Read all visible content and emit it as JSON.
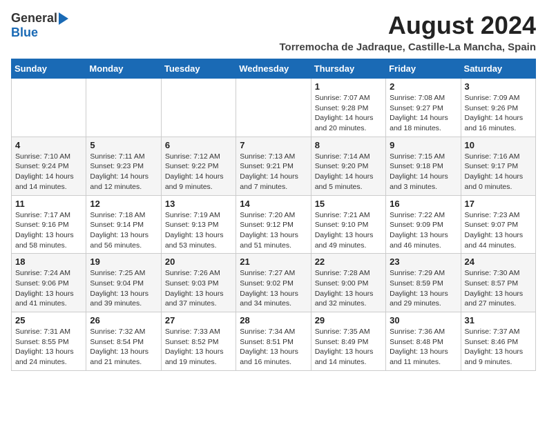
{
  "logo": {
    "general": "General",
    "blue": "Blue"
  },
  "header": {
    "month_year": "August 2024",
    "location": "Torremocha de Jadraque, Castille-La Mancha, Spain"
  },
  "weekdays": [
    "Sunday",
    "Monday",
    "Tuesday",
    "Wednesday",
    "Thursday",
    "Friday",
    "Saturday"
  ],
  "weeks": [
    [
      {
        "day": "",
        "info": ""
      },
      {
        "day": "",
        "info": ""
      },
      {
        "day": "",
        "info": ""
      },
      {
        "day": "",
        "info": ""
      },
      {
        "day": "1",
        "info": "Sunrise: 7:07 AM\nSunset: 9:28 PM\nDaylight: 14 hours and 20 minutes."
      },
      {
        "day": "2",
        "info": "Sunrise: 7:08 AM\nSunset: 9:27 PM\nDaylight: 14 hours and 18 minutes."
      },
      {
        "day": "3",
        "info": "Sunrise: 7:09 AM\nSunset: 9:26 PM\nDaylight: 14 hours and 16 minutes."
      }
    ],
    [
      {
        "day": "4",
        "info": "Sunrise: 7:10 AM\nSunset: 9:24 PM\nDaylight: 14 hours and 14 minutes."
      },
      {
        "day": "5",
        "info": "Sunrise: 7:11 AM\nSunset: 9:23 PM\nDaylight: 14 hours and 12 minutes."
      },
      {
        "day": "6",
        "info": "Sunrise: 7:12 AM\nSunset: 9:22 PM\nDaylight: 14 hours and 9 minutes."
      },
      {
        "day": "7",
        "info": "Sunrise: 7:13 AM\nSunset: 9:21 PM\nDaylight: 14 hours and 7 minutes."
      },
      {
        "day": "8",
        "info": "Sunrise: 7:14 AM\nSunset: 9:20 PM\nDaylight: 14 hours and 5 minutes."
      },
      {
        "day": "9",
        "info": "Sunrise: 7:15 AM\nSunset: 9:18 PM\nDaylight: 14 hours and 3 minutes."
      },
      {
        "day": "10",
        "info": "Sunrise: 7:16 AM\nSunset: 9:17 PM\nDaylight: 14 hours and 0 minutes."
      }
    ],
    [
      {
        "day": "11",
        "info": "Sunrise: 7:17 AM\nSunset: 9:16 PM\nDaylight: 13 hours and 58 minutes."
      },
      {
        "day": "12",
        "info": "Sunrise: 7:18 AM\nSunset: 9:14 PM\nDaylight: 13 hours and 56 minutes."
      },
      {
        "day": "13",
        "info": "Sunrise: 7:19 AM\nSunset: 9:13 PM\nDaylight: 13 hours and 53 minutes."
      },
      {
        "day": "14",
        "info": "Sunrise: 7:20 AM\nSunset: 9:12 PM\nDaylight: 13 hours and 51 minutes."
      },
      {
        "day": "15",
        "info": "Sunrise: 7:21 AM\nSunset: 9:10 PM\nDaylight: 13 hours and 49 minutes."
      },
      {
        "day": "16",
        "info": "Sunrise: 7:22 AM\nSunset: 9:09 PM\nDaylight: 13 hours and 46 minutes."
      },
      {
        "day": "17",
        "info": "Sunrise: 7:23 AM\nSunset: 9:07 PM\nDaylight: 13 hours and 44 minutes."
      }
    ],
    [
      {
        "day": "18",
        "info": "Sunrise: 7:24 AM\nSunset: 9:06 PM\nDaylight: 13 hours and 41 minutes."
      },
      {
        "day": "19",
        "info": "Sunrise: 7:25 AM\nSunset: 9:04 PM\nDaylight: 13 hours and 39 minutes."
      },
      {
        "day": "20",
        "info": "Sunrise: 7:26 AM\nSunset: 9:03 PM\nDaylight: 13 hours and 37 minutes."
      },
      {
        "day": "21",
        "info": "Sunrise: 7:27 AM\nSunset: 9:02 PM\nDaylight: 13 hours and 34 minutes."
      },
      {
        "day": "22",
        "info": "Sunrise: 7:28 AM\nSunset: 9:00 PM\nDaylight: 13 hours and 32 minutes."
      },
      {
        "day": "23",
        "info": "Sunrise: 7:29 AM\nSunset: 8:59 PM\nDaylight: 13 hours and 29 minutes."
      },
      {
        "day": "24",
        "info": "Sunrise: 7:30 AM\nSunset: 8:57 PM\nDaylight: 13 hours and 27 minutes."
      }
    ],
    [
      {
        "day": "25",
        "info": "Sunrise: 7:31 AM\nSunset: 8:55 PM\nDaylight: 13 hours and 24 minutes."
      },
      {
        "day": "26",
        "info": "Sunrise: 7:32 AM\nSunset: 8:54 PM\nDaylight: 13 hours and 21 minutes."
      },
      {
        "day": "27",
        "info": "Sunrise: 7:33 AM\nSunset: 8:52 PM\nDaylight: 13 hours and 19 minutes."
      },
      {
        "day": "28",
        "info": "Sunrise: 7:34 AM\nSunset: 8:51 PM\nDaylight: 13 hours and 16 minutes."
      },
      {
        "day": "29",
        "info": "Sunrise: 7:35 AM\nSunset: 8:49 PM\nDaylight: 13 hours and 14 minutes."
      },
      {
        "day": "30",
        "info": "Sunrise: 7:36 AM\nSunset: 8:48 PM\nDaylight: 13 hours and 11 minutes."
      },
      {
        "day": "31",
        "info": "Sunrise: 7:37 AM\nSunset: 8:46 PM\nDaylight: 13 hours and 9 minutes."
      }
    ]
  ]
}
